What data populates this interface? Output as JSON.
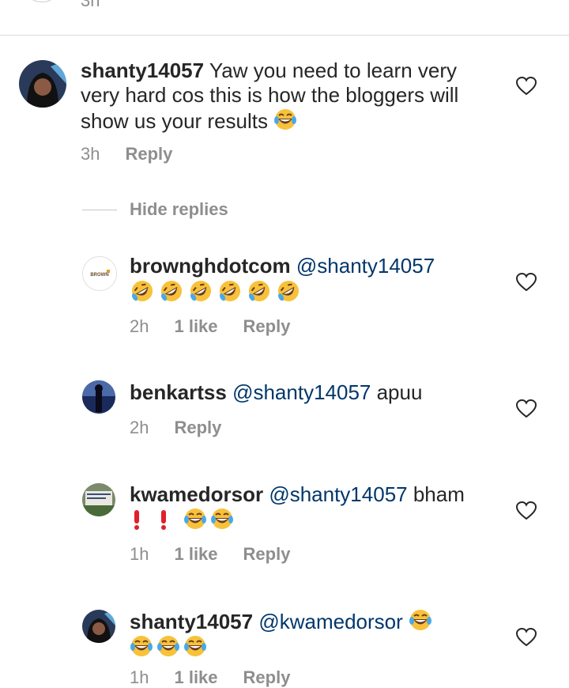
{
  "top": {
    "time": "3h"
  },
  "comments": [
    {
      "username": "shanty14057",
      "text": " Yaw you need to learn very very hard cos this is how the bloggers will show us your results",
      "time": "3h",
      "reply": "Reply"
    }
  ],
  "hide_replies": "Hide replies",
  "replies": [
    {
      "username": "browngh­dotcom",
      "mention": "@shanty14057",
      "text": "",
      "time": "2h",
      "likes": "1 like",
      "reply": "Reply",
      "avatar_text": "BROWN"
    },
    {
      "username": "benkartss",
      "mention": "@shanty14057",
      "text": " apuu",
      "time": "2h",
      "reply": "Reply"
    },
    {
      "username": "kwamedorsor",
      "mention": "@shanty14057",
      "text": " bham",
      "time": "1h",
      "likes": "1 like",
      "reply": "Reply"
    },
    {
      "username": "shanty14057",
      "mention": "@kwamedorsor",
      "text": "",
      "time": "1h",
      "likes": "1 like",
      "reply": "Reply"
    }
  ],
  "icons": {
    "heart": "heart-outline-icon",
    "laugh": "face-with-tears-of-joy-emoji",
    "rofl": "rolling-on-the-floor-laughing-emoji",
    "exclamation": "red-exclamation-emoji"
  },
  "colors": {
    "mention": "#00376b",
    "meta": "#8e8e8e",
    "divider": "#dbdbdb"
  }
}
